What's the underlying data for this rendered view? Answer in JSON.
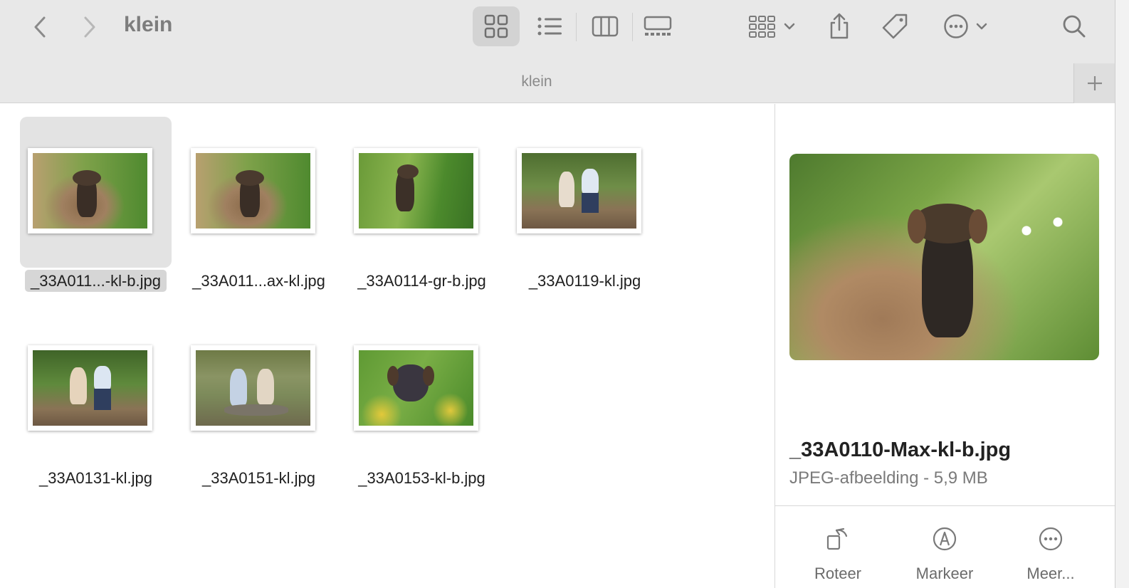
{
  "window": {
    "title": "klein",
    "tab_title": "klein"
  },
  "files": [
    {
      "name": "_33A011...-kl-b.jpg",
      "selected": true
    },
    {
      "name": "_33A011...ax-kl.jpg",
      "selected": false
    },
    {
      "name": "_33A0114-gr-b.jpg",
      "selected": false
    },
    {
      "name": "_33A0119-kl.jpg",
      "selected": false
    },
    {
      "name": "_33A0131-kl.jpg",
      "selected": false
    },
    {
      "name": "_33A0151-kl.jpg",
      "selected": false
    },
    {
      "name": "_33A0153-kl-b.jpg",
      "selected": false
    }
  ],
  "preview": {
    "file_name": "_33A0110-Max-kl-b.jpg",
    "meta": "JPEG-afbeelding - 5,9 MB"
  },
  "actions": {
    "rotate": "Roteer",
    "markup": "Markeer",
    "more": "Meer..."
  },
  "icons": {
    "back": "chevron-left-icon",
    "forward": "chevron-right-icon",
    "grid_view": "grid-view-icon",
    "list_view": "list-view-icon",
    "column_view": "column-view-icon",
    "gallery_view": "gallery-view-icon",
    "group": "group-icon",
    "share": "share-icon",
    "tag": "tag-icon",
    "more": "ellipsis-circle-icon",
    "search": "search-icon",
    "add_tab": "plus-icon"
  },
  "colors": {
    "toolbar_bg": "#e8e8e8",
    "selection_bg": "#e3e3e3"
  }
}
